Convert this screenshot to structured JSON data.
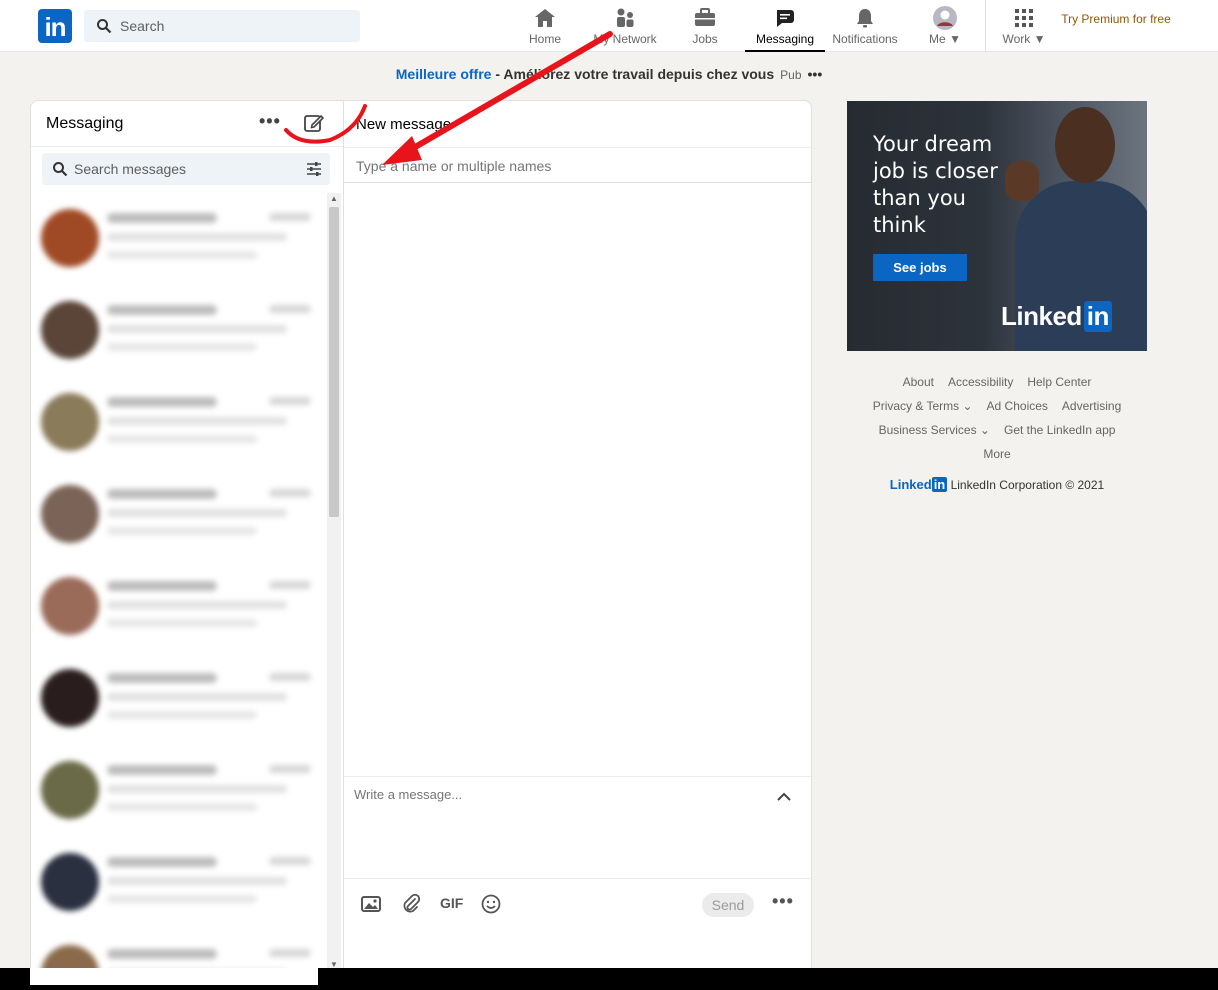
{
  "header": {
    "search_placeholder": "Search",
    "nav": [
      {
        "label": "Home",
        "icon": "home-icon"
      },
      {
        "label": "My Network",
        "icon": "network-icon"
      },
      {
        "label": "Jobs",
        "icon": "briefcase-icon"
      },
      {
        "label": "Messaging",
        "icon": "messaging-icon"
      },
      {
        "label": "Notifications",
        "icon": "bell-icon"
      },
      {
        "label": "Me",
        "icon": "avatar"
      },
      {
        "label": "Work",
        "icon": "grid-icon"
      }
    ],
    "premium": "Try Premium for free",
    "logo_text": "in"
  },
  "ad_line": {
    "offer": "Meilleure offre",
    "text": " - Améliorez votre travail depuis chez vous",
    "pub": "Pub",
    "dots": "•••"
  },
  "messaging": {
    "title": "Messaging",
    "dots": "•••",
    "search_placeholder": "Search messages"
  },
  "new_message": {
    "title": "New message",
    "to_placeholder": "Type a name or multiple names",
    "compose_placeholder": "Write a message...",
    "gif_label": "GIF",
    "send_label": "Send",
    "dots": "•••"
  },
  "ad": {
    "copy": "Your dream job is closer than you think",
    "button": "See jobs",
    "logo_main": "Linked",
    "logo_in": "in"
  },
  "footer": {
    "row1": [
      "About",
      "Accessibility",
      "Help Center"
    ],
    "row2": [
      "Privacy & Terms ⌄",
      "Ad Choices",
      "Advertising"
    ],
    "row3": [
      "Business Services ⌄",
      "Get the LinkedIn app"
    ],
    "row4": [
      "More"
    ],
    "brand_main": "Linked",
    "brand_in": "in",
    "corp_text": "LinkedIn Corporation © 2021"
  },
  "colors": {
    "brand": "#0a66c2",
    "annotation": "#e8141b"
  }
}
